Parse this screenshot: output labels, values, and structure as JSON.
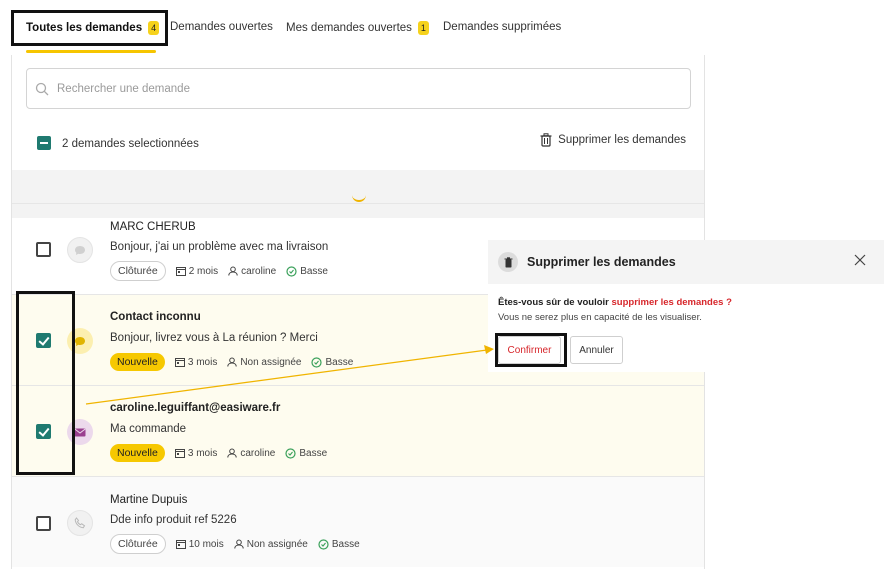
{
  "tabs": [
    {
      "label": "Toutes les demandes",
      "badge": "4"
    },
    {
      "label": "Demandes ouvertes",
      "badge": ""
    },
    {
      "label": "Mes demandes ouvertes",
      "badge": "1"
    },
    {
      "label": "Demandes supprimées",
      "badge": ""
    }
  ],
  "search": {
    "placeholder": "Rechercher une demande"
  },
  "selection": {
    "count_text": "2 demandes selectionnées",
    "delete_label": "Supprimer les demandes"
  },
  "rows": [
    {
      "name": "MARC CHERUB",
      "message": "Bonjour, j'ai un problème avec ma livraison",
      "status": "Clôturée",
      "age": "2 mois",
      "assignee": "caroline",
      "priority": "Basse",
      "checked": false,
      "channel": "chat-icon"
    },
    {
      "name": "Contact inconnu",
      "message": "Bonjour, livrez vous à La réunion ? Merci",
      "status": "Nouvelle",
      "age": "3 mois",
      "assignee": "Non assignée",
      "priority": "Basse",
      "checked": true,
      "channel": "chat-icon"
    },
    {
      "name": "caroline.leguiffant@easiware.fr",
      "message": "Ma commande",
      "status": "Nouvelle",
      "age": "3 mois",
      "assignee": "caroline",
      "priority": "Basse",
      "checked": true,
      "channel": "mail-icon"
    },
    {
      "name": "Martine Dupuis",
      "message": "Dde info produit ref 5226",
      "status": "Clôturée",
      "age": "10 mois",
      "assignee": "Non assignée",
      "priority": "Basse",
      "checked": false,
      "channel": "phone-icon"
    }
  ],
  "dialog": {
    "title": "Supprimer les demandes",
    "question_prefix": "Êtes-vous sûr de vouloir ",
    "question_highlight": "supprimer les demandes ?",
    "subtext": "Vous ne serez plus en capacité de les visualiser.",
    "confirm_label": "Confirmer",
    "cancel_label": "Annuler"
  },
  "colors": {
    "accent_yellow": "#f6c800",
    "check_teal": "#1f7a70",
    "danger_red": "#d7262b",
    "annotation_arrow": "#f0b400"
  }
}
